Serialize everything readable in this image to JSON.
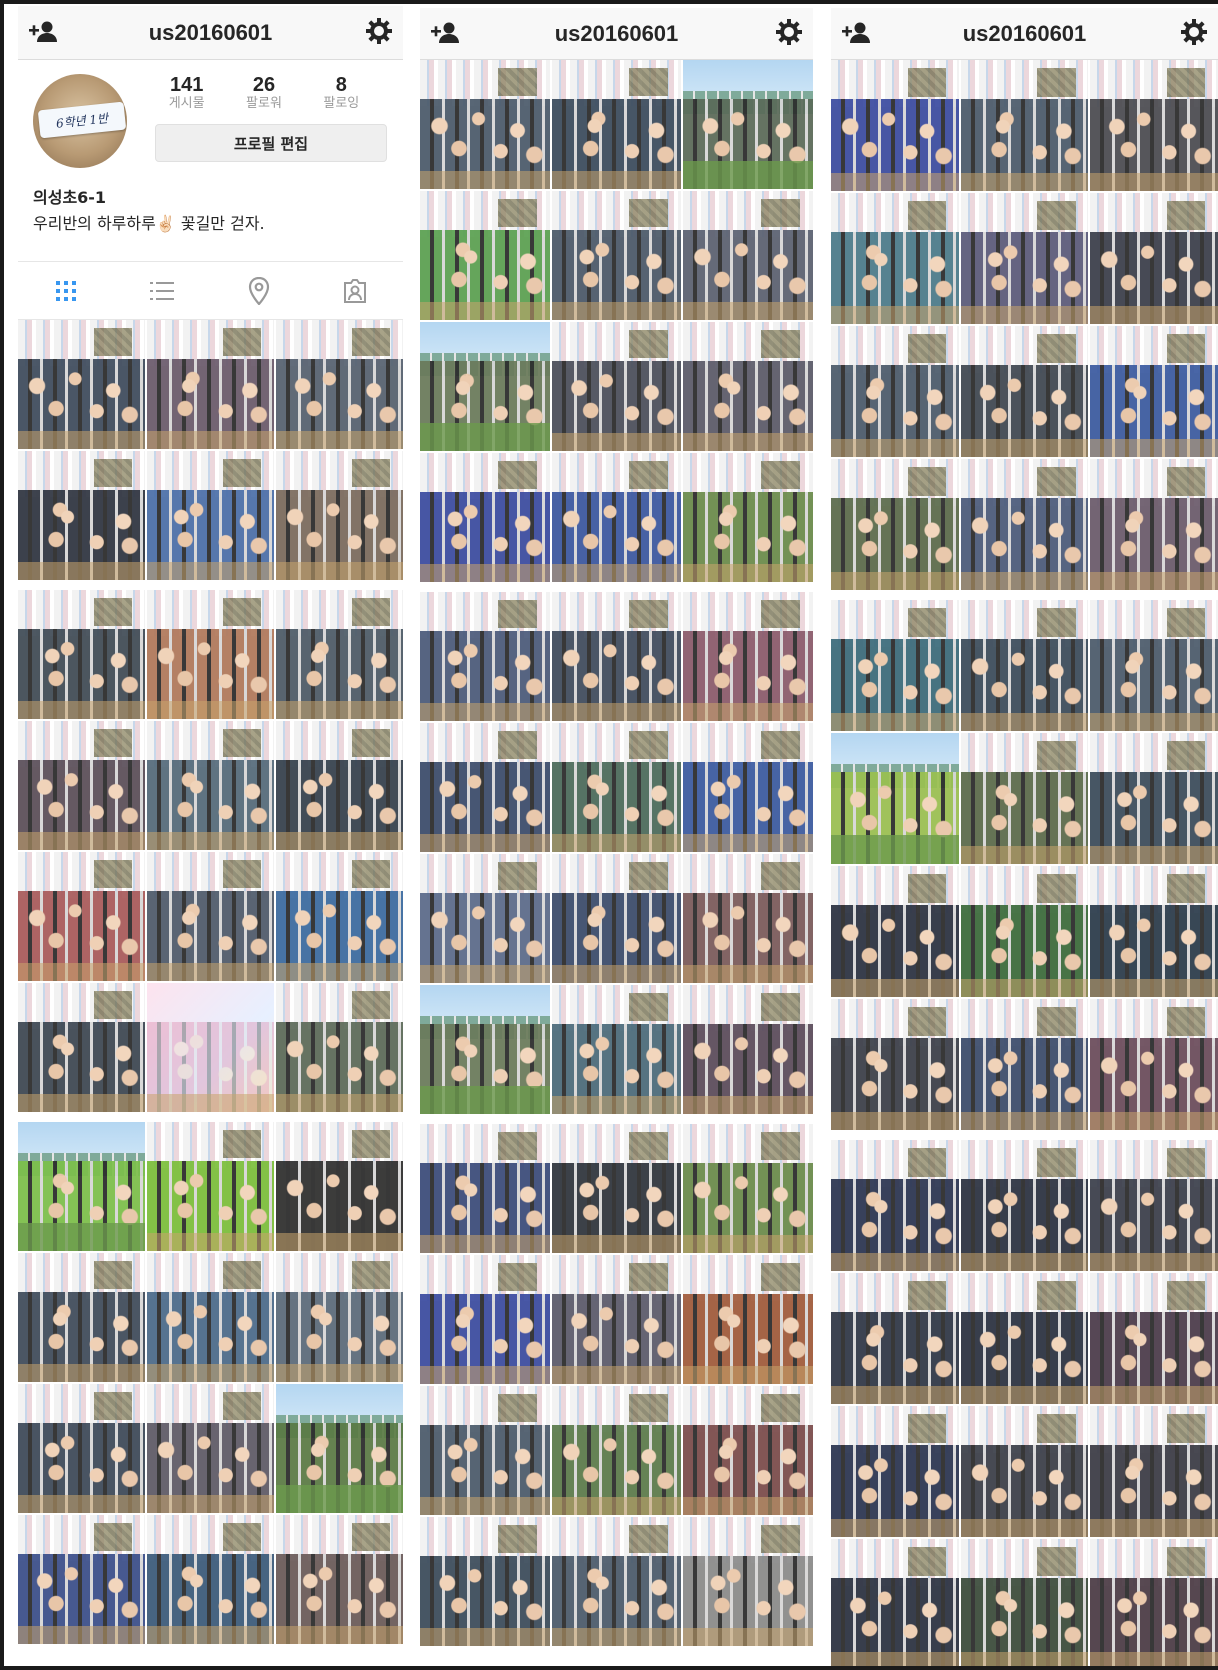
{
  "profile": {
    "username": "us20160601",
    "display_name": "의성초6-1",
    "bio": "우리반의 하루하루✌🏻 꽃길만 걷자.",
    "avatar_card_text": "6학년 1반",
    "stats": [
      {
        "value": "141",
        "label": "게시물"
      },
      {
        "value": "26",
        "label": "팔로워"
      },
      {
        "value": "8",
        "label": "팔로잉"
      }
    ],
    "edit_button_label": "프로필 편집"
  },
  "icons": {
    "add_friend": "add-person-icon",
    "settings": "gear-icon",
    "view_tabs": [
      "grid-view-icon",
      "list-view-icon",
      "location-pin-icon",
      "tagged-person-icon"
    ]
  },
  "colors": {
    "active_tab": "#3897f0",
    "inactive_tab": "#999999",
    "text": "#262626"
  },
  "panels": [
    {
      "id": "p1",
      "segments": [
        [
          {
            "type": "crowd",
            "tint": "#3d4a5c"
          },
          {
            "type": "crowd",
            "tint": "#6a5a6b"
          },
          {
            "type": "crowd",
            "tint": "#55606f"
          },
          {
            "type": "crowd",
            "tint": "#2e3440"
          },
          {
            "type": "crowd",
            "tint": "#4a6ea8"
          },
          {
            "type": "crowd",
            "tint": "#7a6a5c"
          }
        ],
        [
          {
            "type": "crowd",
            "tint": "#3f4a55"
          },
          {
            "type": "crowd",
            "tint": "#b0785a"
          },
          {
            "type": "crowd",
            "tint": "#4c5a66"
          },
          {
            "type": "crowd",
            "tint": "#5a4e58"
          },
          {
            "type": "crowd",
            "tint": "#546a7a"
          },
          {
            "type": "crowd",
            "tint": "#34404c"
          },
          {
            "type": "crowd",
            "tint": "#a85a5a"
          },
          {
            "type": "crowd",
            "tint": "#4e5a6a"
          },
          {
            "type": "crowd",
            "tint": "#3a6aa0"
          },
          {
            "type": "crowd",
            "tint": "#3c4652"
          },
          {
            "type": "special",
            "tint": "#d87aa0"
          },
          {
            "type": "crowd",
            "tint": "#5c6a58"
          }
        ],
        [
          {
            "type": "outdoor",
            "tint": "#7cc04a"
          },
          {
            "type": "crowd",
            "tint": "#7bbf3a"
          },
          {
            "type": "crowd",
            "tint": "#2e2e2e"
          },
          {
            "type": "crowd",
            "tint": "#3e4a5a"
          },
          {
            "type": "crowd",
            "tint": "#4a6a8a"
          },
          {
            "type": "crowd",
            "tint": "#5a6a7a"
          },
          {
            "type": "crowd",
            "tint": "#3c4858"
          },
          {
            "type": "crowd",
            "tint": "#5e5a66"
          },
          {
            "type": "outdoor",
            "tint": "#5a7a44"
          },
          {
            "type": "crowd",
            "tint": "#3a4e8a"
          },
          {
            "type": "crowd",
            "tint": "#3a5a7a"
          },
          {
            "type": "crowd",
            "tint": "#6a5a58"
          }
        ]
      ]
    },
    {
      "id": "p2",
      "segments": [
        [
          {
            "type": "crowd",
            "tint": "#4a5a6a"
          },
          {
            "type": "crowd",
            "tint": "#3a4a5c"
          },
          {
            "type": "outdoor",
            "tint": "#5a6a58"
          },
          {
            "type": "crowd",
            "tint": "#5aa050"
          },
          {
            "type": "crowd",
            "tint": "#4a5868"
          },
          {
            "type": "crowd",
            "tint": "#5a6070"
          },
          {
            "type": "outdoor",
            "tint": "#6a7a5a"
          },
          {
            "type": "crowd",
            "tint": "#4a4e5a"
          },
          {
            "type": "crowd",
            "tint": "#5a5a68"
          },
          {
            "type": "crowd",
            "tint": "#3a4aa0"
          },
          {
            "type": "crowd",
            "tint": "#3a56a0"
          },
          {
            "type": "crowd",
            "tint": "#6a8a4a"
          }
        ],
        [
          {
            "type": "crowd",
            "tint": "#4a5a7a"
          },
          {
            "type": "crowd",
            "tint": "#3e4a5c"
          },
          {
            "type": "crowd",
            "tint": "#8a5a6a"
          },
          {
            "type": "crowd",
            "tint": "#3a4a6a"
          },
          {
            "type": "crowd",
            "tint": "#4a6a5a"
          },
          {
            "type": "crowd",
            "tint": "#3a5aa0"
          },
          {
            "type": "crowd",
            "tint": "#5a6a8a"
          },
          {
            "type": "crowd",
            "tint": "#3a4a6a"
          },
          {
            "type": "crowd",
            "tint": "#7a5a5a"
          },
          {
            "type": "outdoor",
            "tint": "#6a7a5a"
          },
          {
            "type": "crowd",
            "tint": "#4a6a7a"
          },
          {
            "type": "crowd",
            "tint": "#5a4a5a"
          }
        ],
        [
          {
            "type": "crowd",
            "tint": "#3a4a7a"
          },
          {
            "type": "crowd",
            "tint": "#2e343c"
          },
          {
            "type": "crowd",
            "tint": "#6a8a4a"
          },
          {
            "type": "crowd",
            "tint": "#3a4aa0"
          },
          {
            "type": "crowd",
            "tint": "#5a5a6a"
          },
          {
            "type": "crowd",
            "tint": "#a05a3a"
          },
          {
            "type": "crowd",
            "tint": "#4a5a6a"
          },
          {
            "type": "crowd",
            "tint": "#5a7a4a"
          },
          {
            "type": "crowd",
            "tint": "#7a4a4a"
          },
          {
            "type": "crowd",
            "tint": "#3a4a5a"
          },
          {
            "type": "crowd",
            "tint": "#4a5a6a"
          },
          {
            "type": "crowd",
            "tint": "#8a8a8a"
          }
        ]
      ]
    },
    {
      "id": "p3",
      "segments": [
        [
          {
            "type": "crowd",
            "tint": "#3a4aa0"
          },
          {
            "type": "crowd",
            "tint": "#4a5a6a"
          },
          {
            "type": "crowd",
            "tint": "#4a4a50"
          },
          {
            "type": "crowd",
            "tint": "#4a7a8a"
          },
          {
            "type": "crowd",
            "tint": "#5a5a7a"
          },
          {
            "type": "crowd",
            "tint": "#3a3e4a"
          },
          {
            "type": "crowd",
            "tint": "#4a5a6a"
          },
          {
            "type": "crowd",
            "tint": "#3e4650"
          },
          {
            "type": "crowd",
            "tint": "#3a5aa0"
          },
          {
            "type": "crowd",
            "tint": "#5a6a4a"
          },
          {
            "type": "crowd",
            "tint": "#4a5a7a"
          },
          {
            "type": "crowd",
            "tint": "#6a5a6a"
          }
        ],
        [
          {
            "type": "crowd",
            "tint": "#3a6a7a"
          },
          {
            "type": "crowd",
            "tint": "#3a4a5a"
          },
          {
            "type": "crowd",
            "tint": "#4a5a6a"
          },
          {
            "type": "outdoor",
            "tint": "#9ac050"
          },
          {
            "type": "crowd",
            "tint": "#5a6a4a"
          },
          {
            "type": "crowd",
            "tint": "#3a4a5a"
          },
          {
            "type": "crowd",
            "tint": "#2a3040"
          },
          {
            "type": "crowd",
            "tint": "#3a6a3a"
          },
          {
            "type": "crowd",
            "tint": "#2a3a4a"
          },
          {
            "type": "crowd",
            "tint": "#3a3e48"
          },
          {
            "type": "crowd",
            "tint": "#3a4a6a"
          },
          {
            "type": "crowd",
            "tint": "#6a4a5a"
          }
        ],
        [
          {
            "type": "crowd",
            "tint": "#2a3450"
          },
          {
            "type": "crowd",
            "tint": "#2a3040"
          },
          {
            "type": "crowd",
            "tint": "#3a3e4a"
          },
          {
            "type": "crowd",
            "tint": "#2e3646"
          },
          {
            "type": "crowd",
            "tint": "#2a3040"
          },
          {
            "type": "crowd",
            "tint": "#4a3a4a"
          },
          {
            "type": "crowd",
            "tint": "#2a3450"
          },
          {
            "type": "crowd",
            "tint": "#3a3e48"
          },
          {
            "type": "crowd",
            "tint": "#3a3a44"
          },
          {
            "type": "crowd",
            "tint": "#2a3040"
          },
          {
            "type": "crowd",
            "tint": "#3a4a3a"
          },
          {
            "type": "crowd",
            "tint": "#4a3a44"
          }
        ]
      ]
    }
  ]
}
